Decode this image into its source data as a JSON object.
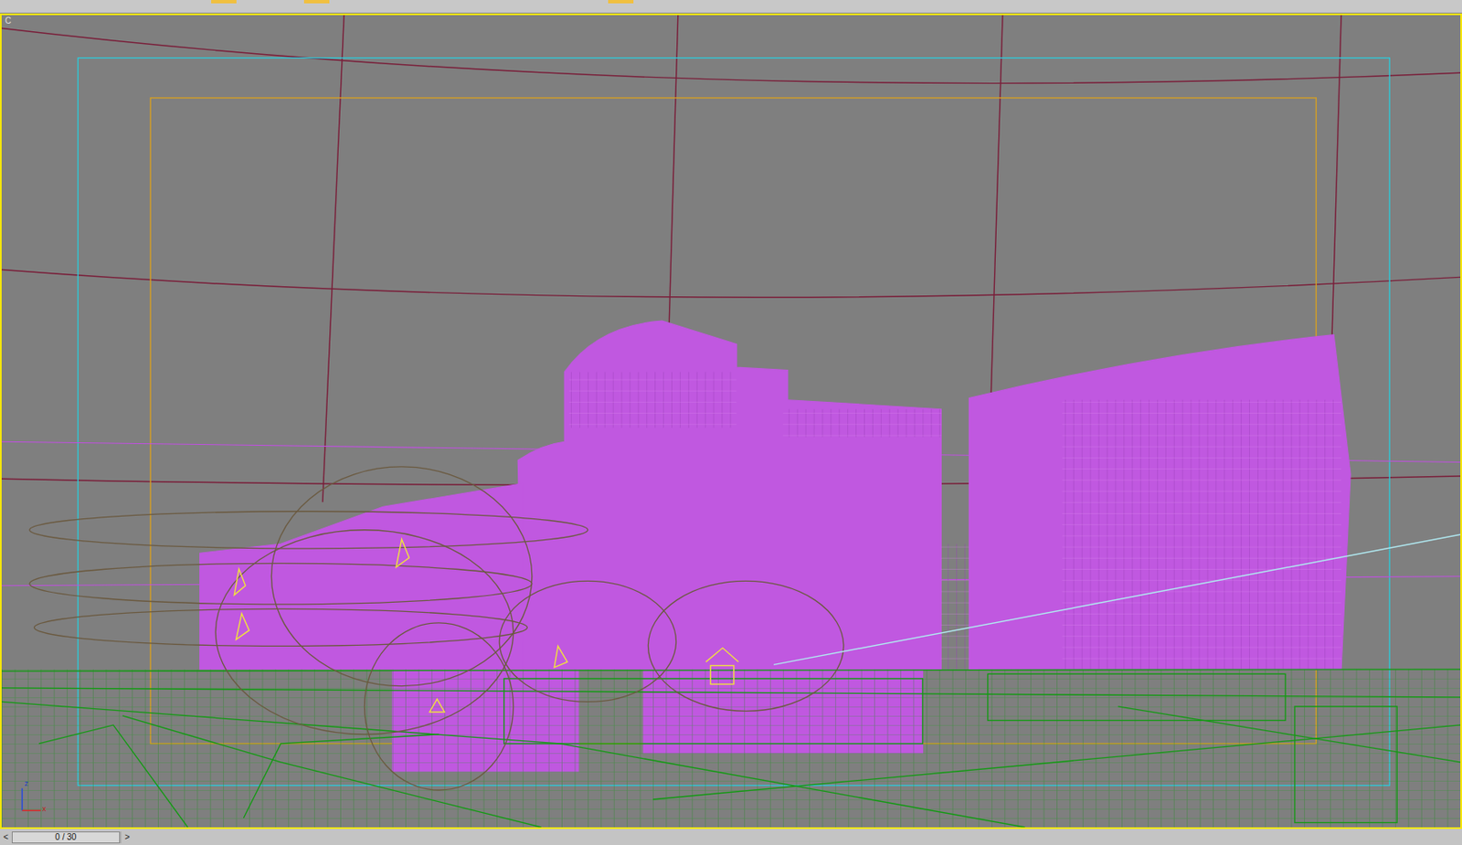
{
  "viewport": {
    "label": "C",
    "active": true
  },
  "axis": {
    "vertical": "z",
    "horizontal": "x"
  },
  "time_slider": {
    "frame": "0 / 30",
    "level": 0,
    "prev": "<",
    "next": ">"
  }
}
